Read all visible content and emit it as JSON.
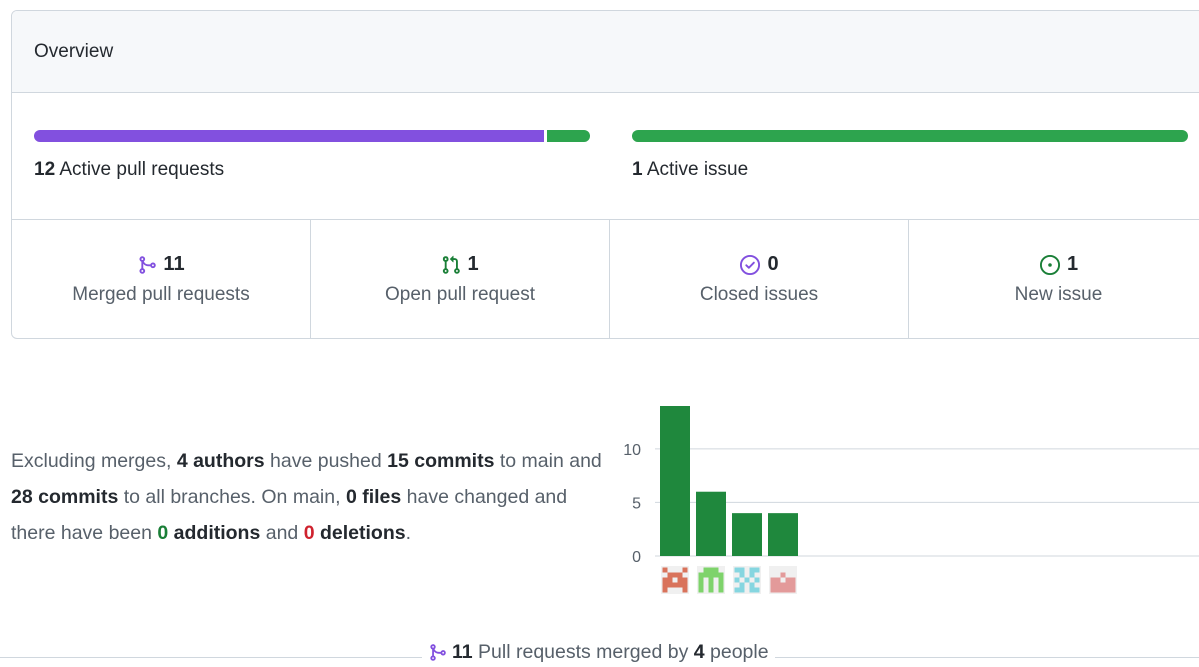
{
  "overview": {
    "title": "Overview",
    "pull_request_bar": {
      "count": "12",
      "label": "Active pull requests",
      "merged_fraction": 0.917,
      "open_fraction": 0.083
    },
    "issue_bar": {
      "count": "1",
      "label": "Active issue",
      "new_fraction": 1.0
    },
    "stats": [
      {
        "icon": "git-merge-icon",
        "value": "11",
        "label": "Merged pull requests",
        "color": "#8250df"
      },
      {
        "icon": "git-pull-request-icon",
        "value": "1",
        "label": "Open pull request",
        "color": "#1a7f37"
      },
      {
        "icon": "issue-closed-icon",
        "value": "0",
        "label": "Closed issues",
        "color": "#8250df"
      },
      {
        "icon": "issue-opened-icon",
        "value": "1",
        "label": "New issue",
        "color": "#1a7f37"
      }
    ]
  },
  "summary": {
    "p1": "Excluding merges, ",
    "authors": "4 authors",
    "p2": " have pushed ",
    "commits_main": "15 commits",
    "p3": " to main and ",
    "commits_all": "28 commits",
    "p4": " to all branches. On main, ",
    "files": "0 files",
    "p5": " have changed and there have been ",
    "additions_num": "0",
    "additions_word": " additions",
    "p6": " and ",
    "deletions_num": "0",
    "deletions_word": " deletions",
    "p7": "."
  },
  "chart_data": {
    "type": "bar",
    "categories": [
      "author-1",
      "author-2",
      "author-3",
      "author-4"
    ],
    "values": [
      14,
      6,
      4,
      4
    ],
    "yticks": [
      0,
      5,
      10
    ],
    "ylim": [
      0,
      14
    ],
    "bar_color": "#1f883d",
    "grid": true,
    "avatar_colors": [
      "#d9735b",
      "#7ed36b",
      "#86d6e0",
      "#e39a9a"
    ]
  },
  "footer": {
    "count": "11",
    "p1": " Pull requests merged by ",
    "people": "4",
    "p2": " people"
  },
  "colors": {
    "merged_purple": "#8250df",
    "open_green": "#2da44e",
    "border": "#d0d7de"
  }
}
